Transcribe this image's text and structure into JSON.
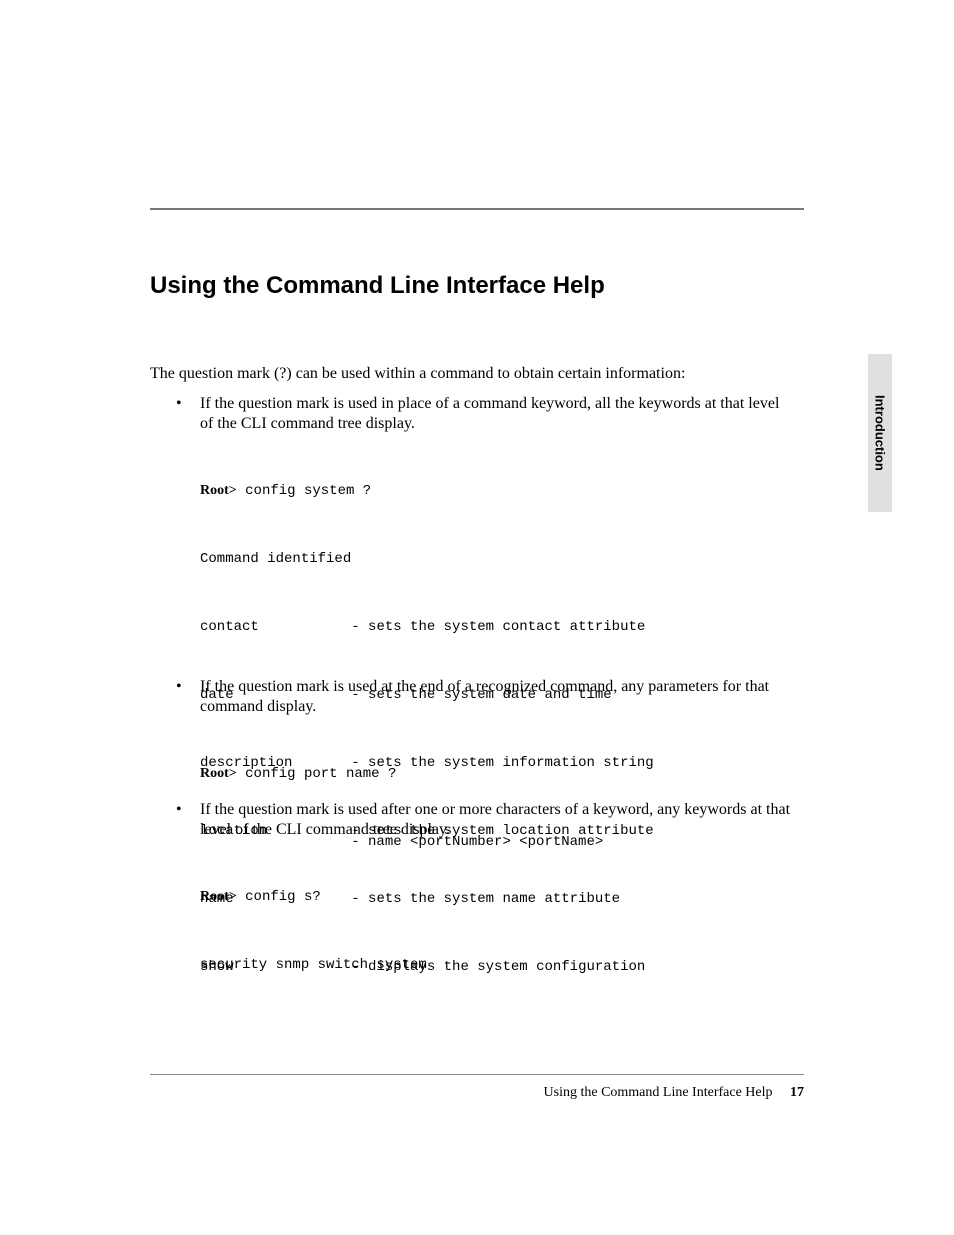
{
  "heading": "Using the Command Line Interface Help",
  "intro": "The question mark (?) can be used within a command to obtain certain information:",
  "side_tab": "Introduction",
  "footer": {
    "title": "Using the Command Line Interface Help",
    "page": "17"
  },
  "section1": {
    "text": "If the question mark is used in place of a command keyword, all the keywords at that level of the CLI command tree display.",
    "prompt": "Root>",
    "cmd": " config system ?",
    "ident": "Command identified",
    "rows": [
      {
        "k": "contact",
        "d": "- sets the system contact attribute"
      },
      {
        "k": "date",
        "d": "- sets the system date and time"
      },
      {
        "k": "description",
        "d": "- sets the system information string"
      },
      {
        "k": "location",
        "d": "- sets the system location attribute"
      },
      {
        "k": "name",
        "d": "- sets the system name attribute"
      },
      {
        "k": "show",
        "d": "- displays the system configuration"
      }
    ]
  },
  "section2": {
    "text": "If the question mark is used at the end of a recognized command, any parameters for that command display.",
    "prompt": "Root>",
    "cmd": " config port name ?",
    "out": "                  - name <portNumber> <portName>"
  },
  "section3": {
    "text": "If the question mark is used after one or more characters of a keyword, any keywords at that level of the CLI command tree display.",
    "prompt": "Root>",
    "cmd": " config s?",
    "out": "security snmp switch system"
  }
}
